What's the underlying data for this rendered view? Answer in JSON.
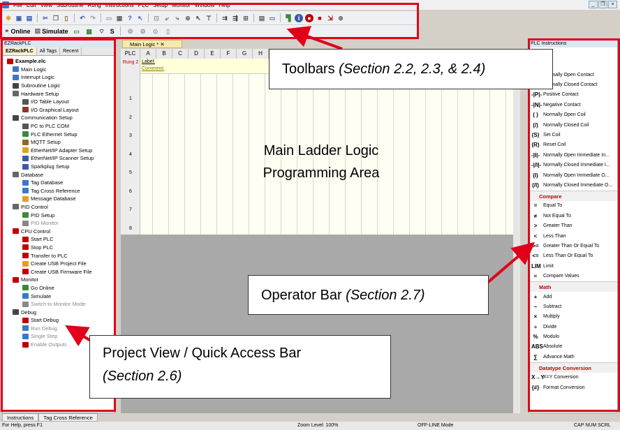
{
  "menu": [
    "File",
    "Edit",
    "View",
    "Subroutine",
    "Rung",
    "Instructions",
    "PLC",
    "Setup",
    "Monitor",
    "Window",
    "Help"
  ],
  "toolbar2": {
    "online": "Online",
    "simulate": "Simulate",
    "s": "S"
  },
  "project": {
    "title": "EZRackPLC",
    "tabs": [
      "EZRackPLC",
      "All Tags",
      "Recent"
    ],
    "items": [
      {
        "label": "Example.elc",
        "level": 0,
        "color": "#c00000"
      },
      {
        "label": "Main Logic",
        "level": 1,
        "color": "#3a78c8"
      },
      {
        "label": "Interrupt Logic",
        "level": 1,
        "color": "#3a78c8"
      },
      {
        "label": "Subroutine Logic",
        "level": 1,
        "color": "#444444"
      },
      {
        "label": "Hardware Setup",
        "level": 1,
        "color": "#666666"
      },
      {
        "label": "I/O Table Layout",
        "level": 2,
        "color": "#555555"
      },
      {
        "label": "I/O Graphical Layout",
        "level": 2,
        "color": "#8a3a2a"
      },
      {
        "label": "Communication Setup",
        "level": 1,
        "color": "#444444"
      },
      {
        "label": "PC to PLC COM",
        "level": 2,
        "color": "#555555"
      },
      {
        "label": "PLC Ethernet Setup",
        "level": 2,
        "color": "#3a8a3a"
      },
      {
        "label": "MQTT Setup",
        "level": 2,
        "color": "#8a6a2a"
      },
      {
        "label": "EtherNet/IP Adapter Setup",
        "level": 2,
        "color": "#e0a020"
      },
      {
        "label": "EtherNet/IP Scanner Setup",
        "level": 2,
        "color": "#3a5aa8"
      },
      {
        "label": "Sparkplug Setup",
        "level": 2,
        "color": "#3a5aa8"
      },
      {
        "label": "Database",
        "level": 1,
        "color": "#666666"
      },
      {
        "label": "Tag Database",
        "level": 2,
        "color": "#3a78c8"
      },
      {
        "label": "Tag Cross Reference",
        "level": 2,
        "color": "#3a78c8"
      },
      {
        "label": "Message Database",
        "level": 2,
        "color": "#e0a020"
      },
      {
        "label": "PID Control",
        "level": 1,
        "color": "#666666"
      },
      {
        "label": "PID Setup",
        "level": 2,
        "color": "#3a8a3a"
      },
      {
        "label": "PID Monitor",
        "level": 2,
        "color": "#888888",
        "grey": true
      },
      {
        "label": "CPU Control",
        "level": 1,
        "color": "#c00000"
      },
      {
        "label": "Start PLC",
        "level": 2,
        "color": "#c00000"
      },
      {
        "label": "Stop PLC",
        "level": 2,
        "color": "#c00000"
      },
      {
        "label": "Transfer to PLC",
        "level": 2,
        "color": "#c00000"
      },
      {
        "label": "Create USB Project File",
        "level": 2,
        "color": "#e0a020"
      },
      {
        "label": "Create USB Firmware File",
        "level": 2,
        "color": "#c00000"
      },
      {
        "label": "Monitor",
        "level": 1,
        "color": "#c00000"
      },
      {
        "label": "Go Online",
        "level": 2,
        "color": "#3a8a3a"
      },
      {
        "label": "Simulate",
        "level": 2,
        "color": "#3a78c8"
      },
      {
        "label": "Switch to Monitor Mode",
        "level": 2,
        "color": "#888888",
        "grey": true
      },
      {
        "label": "Debug",
        "level": 1,
        "color": "#444444"
      },
      {
        "label": "Start Debug",
        "level": 2,
        "color": "#c00000"
      },
      {
        "label": "Run Debug",
        "level": 2,
        "color": "#3a78c8",
        "grey": true
      },
      {
        "label": "Single Step",
        "level": 2,
        "color": "#3a78c8",
        "grey": true
      },
      {
        "label": "Enable Outputs",
        "level": 2,
        "color": "#c00000",
        "grey": true
      }
    ]
  },
  "doc_tab": "Main Logic *",
  "ladder": {
    "head": [
      "PLC",
      "A",
      "B",
      "C",
      "D",
      "E",
      "F",
      "G",
      "H"
    ],
    "rung_label": "Rung 2",
    "label_text": "Label:",
    "comment_text": "Comment:",
    "rungs": [
      "1",
      "2",
      "3",
      "4",
      "5",
      "6",
      "7",
      "8"
    ]
  },
  "instructions": {
    "title": "PLC Instructions",
    "rows1": [
      {
        "sym": "",
        "label": "Normally Open Contact"
      },
      {
        "sym": "",
        "label": "Normally Closed Contact"
      },
      {
        "sym": "-|P|-",
        "label": "Positive Contact"
      },
      {
        "sym": "-|N|-",
        "label": "Negative Contact"
      },
      {
        "sym": "( )",
        "label": "Normally Open Coil"
      },
      {
        "sym": "(/)",
        "label": "Normally Closed Coil"
      },
      {
        "sym": "(S)",
        "label": "Set Coil"
      },
      {
        "sym": "(R)",
        "label": "Reset Coil"
      },
      {
        "sym": "-|I|-",
        "label": "Normally Open Immediate In..."
      },
      {
        "sym": "-|/I|-",
        "label": "Normally Closed Immediate I..."
      },
      {
        "sym": "(I)",
        "label": "Normally Open Immediate O..."
      },
      {
        "sym": "(/I)",
        "label": "Normally Closed Immediate O..."
      }
    ],
    "compare_header": "Compare",
    "rows2": [
      {
        "sym": "=",
        "label": "Equal To"
      },
      {
        "sym": "≠",
        "label": "Not Equal To"
      },
      {
        "sym": ">",
        "label": "Greater Than"
      },
      {
        "sym": "<",
        "label": "Less Than"
      },
      {
        "sym": ">=",
        "label": "Greater Than Or Equal To"
      },
      {
        "sym": "<=",
        "label": "Less Than Or Equal To"
      },
      {
        "sym": "LIM",
        "label": "Limit"
      },
      {
        "sym": "≈",
        "label": "Compare Values"
      }
    ],
    "math_header": "Math",
    "rows3": [
      {
        "sym": "+",
        "label": "Add"
      },
      {
        "sym": "−",
        "label": "Subtract"
      },
      {
        "sym": "×",
        "label": "Multiply"
      },
      {
        "sym": "÷",
        "label": "Divide"
      },
      {
        "sym": "%",
        "label": "Modulo"
      },
      {
        "sym": "ABS",
        "label": "Absolute"
      },
      {
        "sym": "∑",
        "label": "Advance Math"
      }
    ],
    "dtc_header": "Datatype Conversion",
    "rows4": [
      {
        "sym": "X→Y",
        "label": "X=Y Conversion"
      },
      {
        "sym": "{#}",
        "label": "Format Conversion"
      }
    ]
  },
  "bottom_tabs": [
    "Instructions",
    "Tag Cross Reference"
  ],
  "status": {
    "help": "For Help, press F1",
    "zoom": "Zoom Level: 100%",
    "mode": "OFF-LINE Mode",
    "keys": "CAP NUM SCRL"
  },
  "callouts": {
    "toolbars_text": "Toolbars ",
    "toolbars_sec": "(Section 2.2, 2.3, & 2.4)",
    "main_l1": "Main Ladder Logic",
    "main_l2": "Programming Area",
    "operator_text": "Operator Bar ",
    "operator_sec": "(Section 2.7)",
    "project_l1": "Project View / Quick Access Bar",
    "project_sec": "(Section 2.6)"
  },
  "colors": {
    "annotation_red": "#e0001a",
    "rung_red": "#c00000"
  }
}
